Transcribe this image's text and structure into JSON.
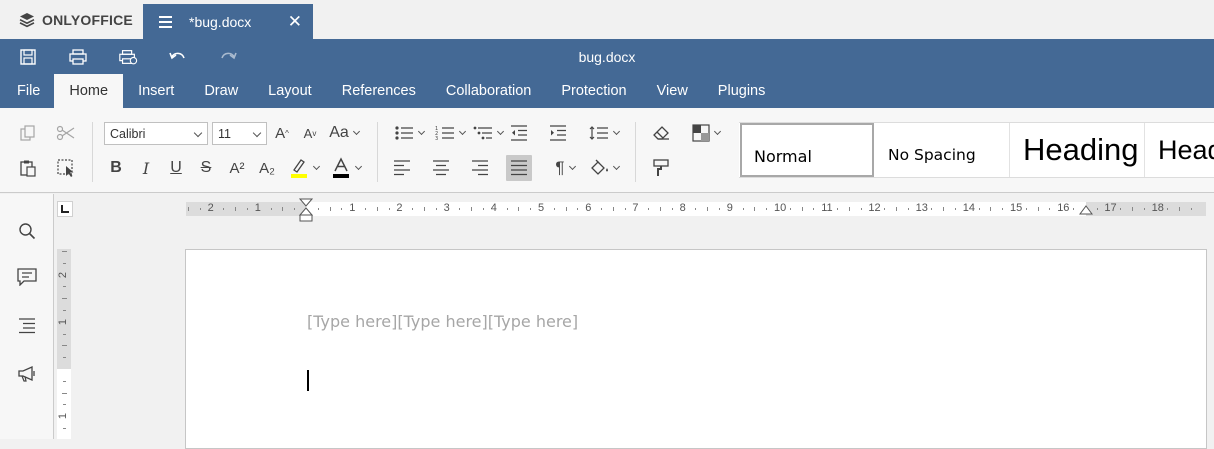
{
  "app": {
    "brand": "ONLYOFFICE"
  },
  "tab": {
    "label": "*bug.docx"
  },
  "header": {
    "title": "bug.docx"
  },
  "menu_tabs": [
    "File",
    "Home",
    "Insert",
    "Draw",
    "Layout",
    "References",
    "Collaboration",
    "Protection",
    "View",
    "Plugins"
  ],
  "toolbar": {
    "font_name": "Calibri",
    "font_size": "11",
    "bold": "B",
    "italic": "I",
    "underline": "U",
    "strike": "S",
    "superscript": "A²",
    "subscript": "A₂",
    "change_case": "Aa",
    "grow_font": "A",
    "shrink_font": "A",
    "pilcrow": "¶"
  },
  "styles": [
    "Normal",
    "No Spacing",
    "Heading",
    "Head"
  ],
  "colors": {
    "brand": "#446995",
    "highlight": "#ffff00",
    "font_color": "#000000"
  },
  "ruler": {
    "top_numbers": [
      "2",
      "1",
      "1",
      "2",
      "3",
      "4",
      "5",
      "6",
      "7",
      "8",
      "9",
      "10",
      "11",
      "12",
      "13",
      "14",
      "15",
      "16",
      "17",
      "18"
    ],
    "left_numbers": [
      "2",
      "1",
      "1"
    ]
  },
  "document": {
    "placeholder": "[Type here][Type here][Type here]"
  }
}
